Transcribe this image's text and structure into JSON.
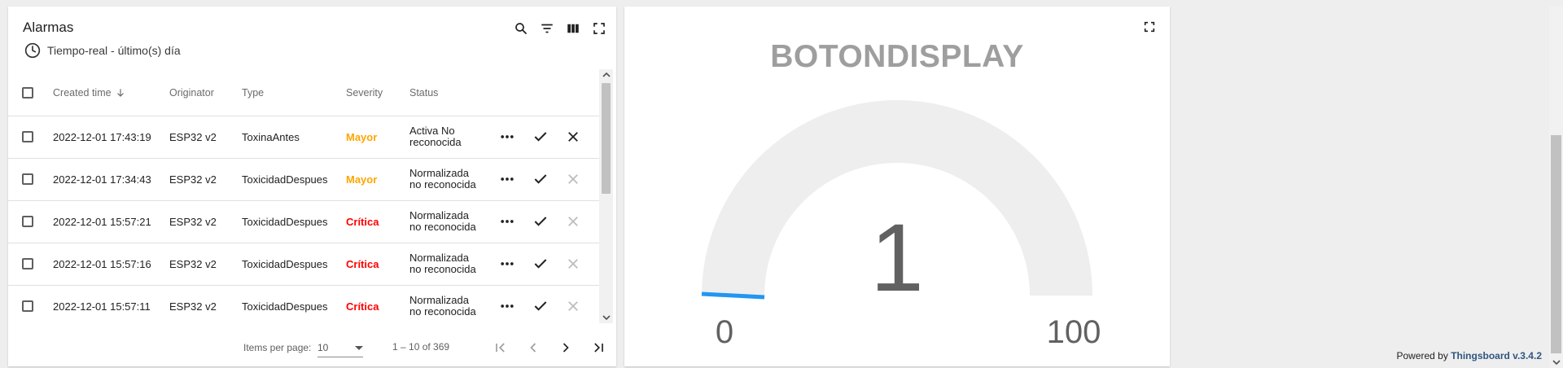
{
  "alarm_widget": {
    "title": "Alarmas",
    "timewindow": "Tiempo-real - último(s) día",
    "columns": [
      "Created time",
      "Originator",
      "Type",
      "Severity",
      "Status"
    ],
    "rows": [
      {
        "created": "2022-12-01 17:43:19",
        "originator": "ESP32 v2",
        "type": "ToxinaAntes",
        "severity": "Mayor",
        "status1": "Activa No",
        "status2": "reconocida"
      },
      {
        "created": "2022-12-01 17:34:43",
        "originator": "ESP32 v2",
        "type": "ToxicidadDespues",
        "severity": "Mayor",
        "status1": "Normalizada",
        "status2": "no reconocida"
      },
      {
        "created": "2022-12-01 15:57:21",
        "originator": "ESP32 v2",
        "type": "ToxicidadDespues",
        "severity": "Crítica",
        "status1": "Normalizada",
        "status2": "no reconocida"
      },
      {
        "created": "2022-12-01 15:57:16",
        "originator": "ESP32 v2",
        "type": "ToxicidadDespues",
        "severity": "Crítica",
        "status1": "Normalizada",
        "status2": "no reconocida"
      },
      {
        "created": "2022-12-01 15:57:11",
        "originator": "ESP32 v2",
        "type": "ToxicidadDespues",
        "severity": "Crítica",
        "status1": "Normalizada",
        "status2": "no reconocida"
      }
    ],
    "pager": {
      "items_per_page_label": "Items per page:",
      "items_per_page_value": "10",
      "range": "1 – 10 of 369"
    }
  },
  "gauge_widget": {
    "title": "BOTONDISPLAY",
    "value": 1,
    "min": 0,
    "max": 100,
    "value_text": "1",
    "min_text": "0",
    "max_text": "100"
  },
  "footer": {
    "powered_by": "Powered by",
    "brand": "Thingsboard v.3.4.2"
  },
  "colors": {
    "severity_major": "#ffa500",
    "severity_critical": "#ff0000",
    "gauge_bar": "#2196f3",
    "gauge_track": "#eeeeee"
  }
}
